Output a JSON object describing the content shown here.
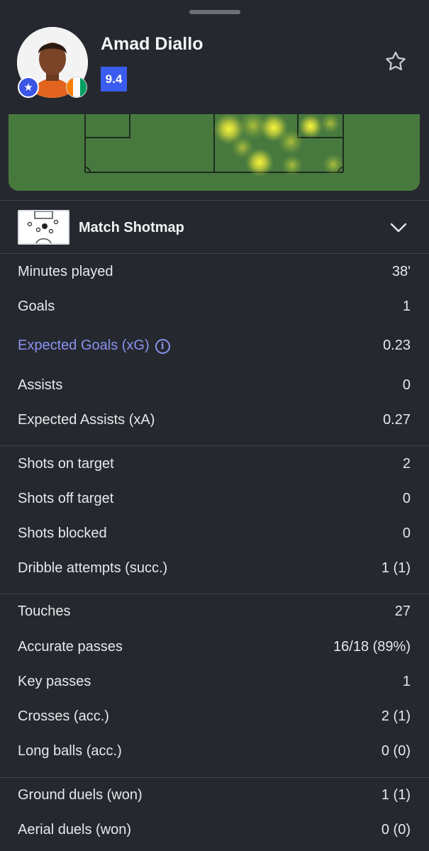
{
  "player": {
    "name": "Amad Diallo",
    "rating": "9.4",
    "flag_colors": [
      "#f77f00",
      "#ffffff",
      "#009e60"
    ]
  },
  "icons": {
    "badge": "star-icon",
    "favorite": "favorite-star-icon",
    "expand": "chevron-down-icon",
    "info": "info-icon"
  },
  "colors": {
    "background": "#25282e",
    "accent": "#3b5cf0",
    "link": "#8a93f0",
    "pitch": "#47793f"
  },
  "shotmap": {
    "label": "Match Shotmap"
  },
  "stats": {
    "minutes_played": {
      "label": "Minutes played",
      "value": "38'"
    },
    "goals": {
      "label": "Goals",
      "value": "1"
    },
    "xg": {
      "label": "Expected Goals (xG)",
      "value": "0.23"
    },
    "assists": {
      "label": "Assists",
      "value": "0"
    },
    "xa": {
      "label": "Expected Assists (xA)",
      "value": "0.27"
    },
    "shots_on_target": {
      "label": "Shots on target",
      "value": "2"
    },
    "shots_off_target": {
      "label": "Shots off target",
      "value": "0"
    },
    "shots_blocked": {
      "label": "Shots blocked",
      "value": "0"
    },
    "dribbles": {
      "label": "Dribble attempts (succ.)",
      "value": "1 (1)"
    },
    "touches": {
      "label": "Touches",
      "value": "27"
    },
    "accurate_passes": {
      "label": "Accurate passes",
      "value": "16/18 (89%)"
    },
    "key_passes": {
      "label": "Key passes",
      "value": "1"
    },
    "crosses": {
      "label": "Crosses (acc.)",
      "value": "2 (1)"
    },
    "long_balls": {
      "label": "Long balls (acc.)",
      "value": "0 (0)"
    },
    "ground_duels": {
      "label": "Ground duels (won)",
      "value": "1 (1)"
    },
    "aerial_duels": {
      "label": "Aerial duels (won)",
      "value": "0 (0)"
    }
  }
}
